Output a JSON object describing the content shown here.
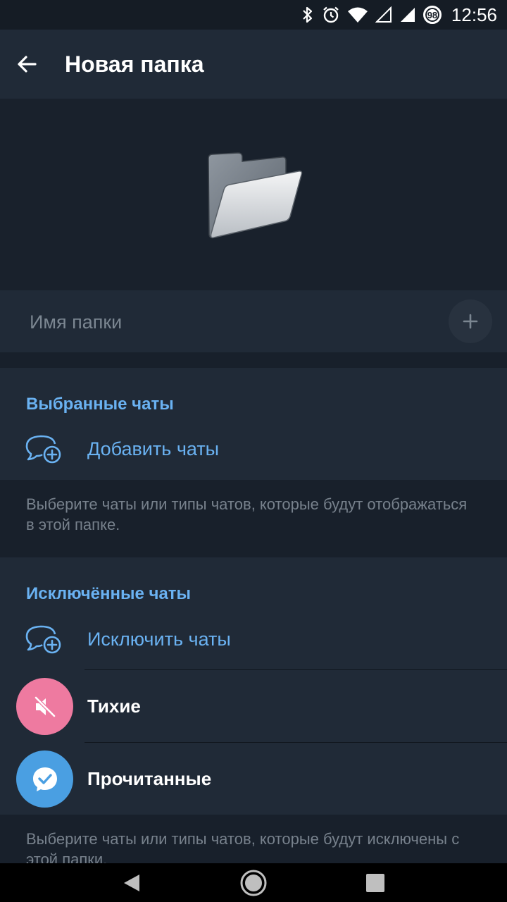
{
  "status_bar": {
    "time": "12:56",
    "battery_level": "98",
    "icons": [
      "bluetooth-icon",
      "alarm-icon",
      "wifi-icon",
      "cell-signal-empty-icon",
      "cell-signal-icon",
      "battery-saver-icon"
    ]
  },
  "app_bar": {
    "title": "Новая папка",
    "back_icon": "arrow-back-icon"
  },
  "folder_name": {
    "placeholder": "Имя папки",
    "value": "",
    "emoji_button_icon": "plus-icon"
  },
  "included": {
    "header": "Выбранные чаты",
    "add_label": "Добавить чаты",
    "add_icon": "chat-add-icon",
    "hint": "Выберите чаты или типы чатов, которые будут отображаться в этой папке."
  },
  "excluded": {
    "header": "Исключённые чаты",
    "exclude_label": "Исключить чаты",
    "exclude_icon": "chat-add-icon",
    "items": [
      {
        "label": "Тихие",
        "icon": "muted-icon",
        "color": "#ee7aa0"
      },
      {
        "label": "Прочитанные",
        "icon": "read-chat-icon",
        "color": "#4a9fe2"
      }
    ],
    "hint": "Выберите чаты или типы чатов, которые будут исключены с этой папки."
  },
  "colors": {
    "accent": "#6ab2f2",
    "background": "#18202b",
    "surface": "#202a37",
    "hint_text": "#77818c"
  }
}
